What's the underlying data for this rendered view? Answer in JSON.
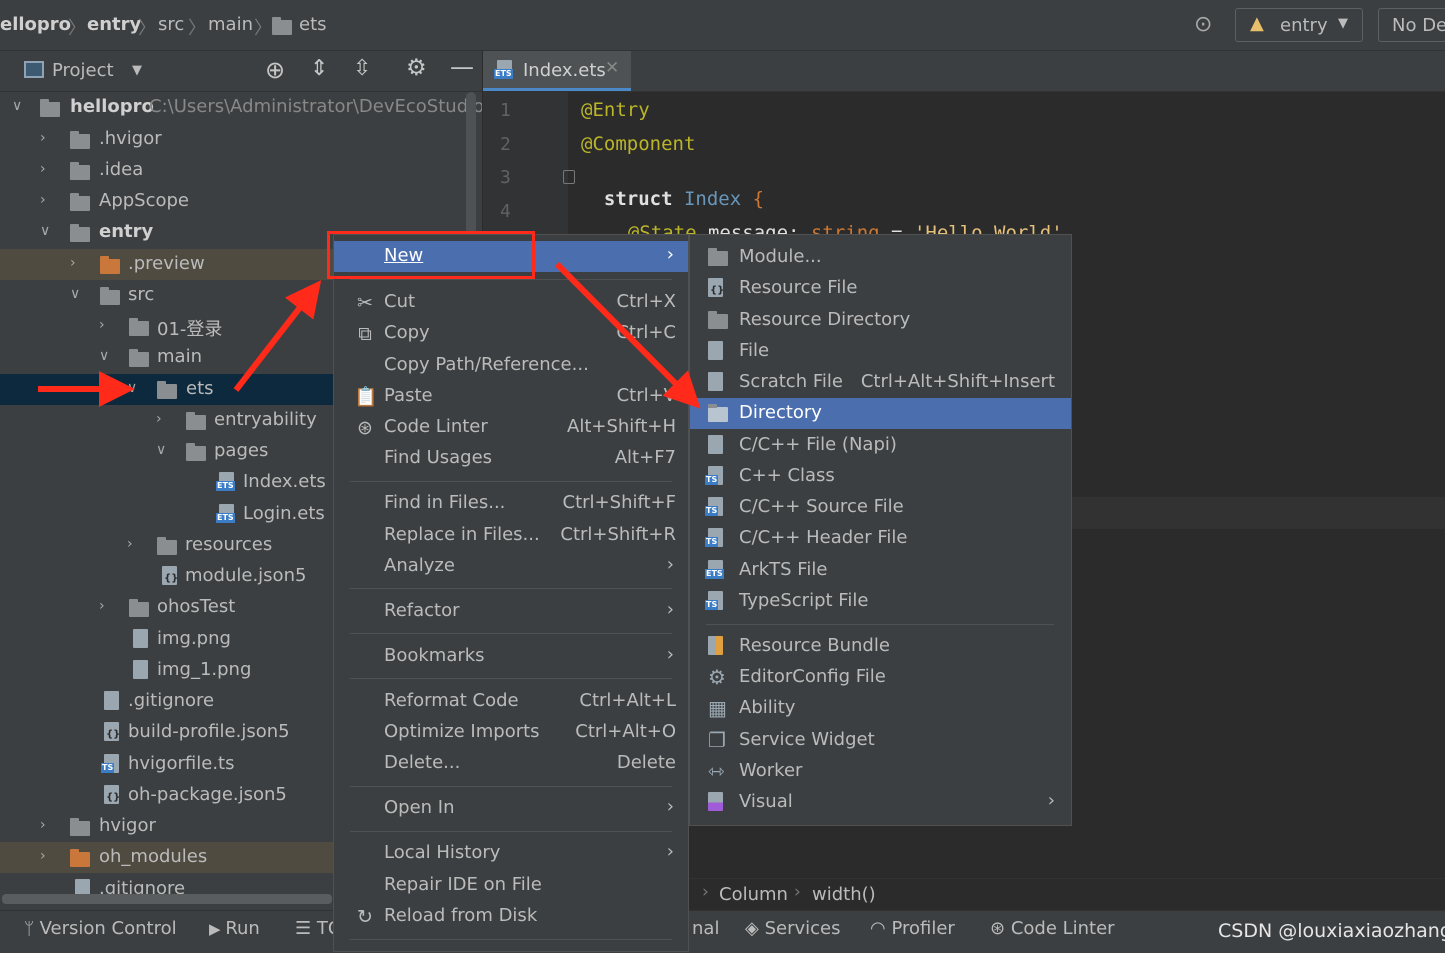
{
  "breadcrumb": {
    "items": [
      "ellopro",
      "entry",
      "src",
      "main",
      "ets"
    ]
  },
  "toolbar": {
    "run_config": "entry",
    "device": "No De"
  },
  "project_panel": {
    "title": "Project"
  },
  "tree": {
    "root_name": "hellopro",
    "root_path": "C:\\Users\\Administrator\\DevEcoStudioPro",
    "rows": [
      {
        "label": ".hvigor"
      },
      {
        "label": ".idea"
      },
      {
        "label": "AppScope"
      },
      {
        "label": "entry"
      },
      {
        "label": ".preview"
      },
      {
        "label": "src"
      },
      {
        "label": "01-登录"
      },
      {
        "label": "main"
      },
      {
        "label": "ets"
      },
      {
        "label": "entryability"
      },
      {
        "label": "pages"
      },
      {
        "label": "Index.ets"
      },
      {
        "label": "Login.ets"
      },
      {
        "label": "resources"
      },
      {
        "label": "module.json5"
      },
      {
        "label": "ohosTest"
      },
      {
        "label": "img.png"
      },
      {
        "label": "img_1.png"
      },
      {
        "label": ".gitignore"
      },
      {
        "label": "build-profile.json5"
      },
      {
        "label": "hvigorfile.ts"
      },
      {
        "label": "oh-package.json5"
      },
      {
        "label": "hvigor"
      },
      {
        "label": "oh_modules"
      },
      {
        "label": ".gitignore"
      }
    ]
  },
  "editor": {
    "tab": "Index.ets",
    "line_numbers": [
      "1",
      "2",
      "3",
      "4"
    ],
    "code": {
      "l1": "@Entry",
      "l2": "@Component",
      "l3_kw": "struct",
      "l3_name": "Index",
      "l3_brace": "{",
      "l4_ann": "@State",
      "l4_name": "message:",
      "l4_type": "string",
      "l4_eq": "=",
      "l4_str": "'Hello World'"
    },
    "bottom_crumb": [
      "Column",
      "width()"
    ]
  },
  "context_menu": {
    "new": "New",
    "cut": "Cut",
    "cut_sc": "Ctrl+X",
    "copy": "Copy",
    "copy_sc": "Ctrl+C",
    "copy_path": "Copy Path/Reference...",
    "paste": "Paste",
    "paste_sc": "Ctrl+V",
    "code_linter": "Code Linter",
    "code_linter_sc": "Alt+Shift+H",
    "find_usages": "Find Usages",
    "find_usages_sc": "Alt+F7",
    "find_in_files": "Find in Files...",
    "find_in_files_sc": "Ctrl+Shift+F",
    "replace_in_files": "Replace in Files...",
    "replace_in_files_sc": "Ctrl+Shift+R",
    "analyze": "Analyze",
    "refactor": "Refactor",
    "bookmarks": "Bookmarks",
    "reformat": "Reformat Code",
    "reformat_sc": "Ctrl+Alt+L",
    "optimize": "Optimize Imports",
    "optimize_sc": "Ctrl+Alt+O",
    "delete": "Delete...",
    "delete_sc": "Delete",
    "open_in": "Open In",
    "local_history": "Local History",
    "repair": "Repair IDE on File",
    "reload": "Reload from Disk"
  },
  "submenu": {
    "module": "Module...",
    "resource_file": "Resource File",
    "resource_dir": "Resource Directory",
    "file": "File",
    "scratch": "Scratch File",
    "scratch_sc": "Ctrl+Alt+Shift+Insert",
    "directory": "Directory",
    "c_napi": "C/C++ File (Napi)",
    "cpp_class": "C++ Class",
    "c_source": "C/C++ Source File",
    "c_header": "C/C++ Header File",
    "arkts": "ArkTS File",
    "typescript": "TypeScript File",
    "resource_bundle": "Resource Bundle",
    "editorconfig": "EditorConfig File",
    "ability": "Ability",
    "service_widget": "Service Widget",
    "worker": "Worker",
    "visual": "Visual"
  },
  "statusbar": {
    "version_control": "Version Control",
    "run": "Run",
    "todo": "TO",
    "terminal": "nal",
    "services": "Services",
    "profiler": "Profiler",
    "code_linter": "Code Linter"
  },
  "watermark": "CSDN @louxiaxiaozhang",
  "colors": {
    "highlight": "#4b6eaf",
    "annotation_red": "#ff2a1a",
    "selection_row": "#0d293e"
  }
}
